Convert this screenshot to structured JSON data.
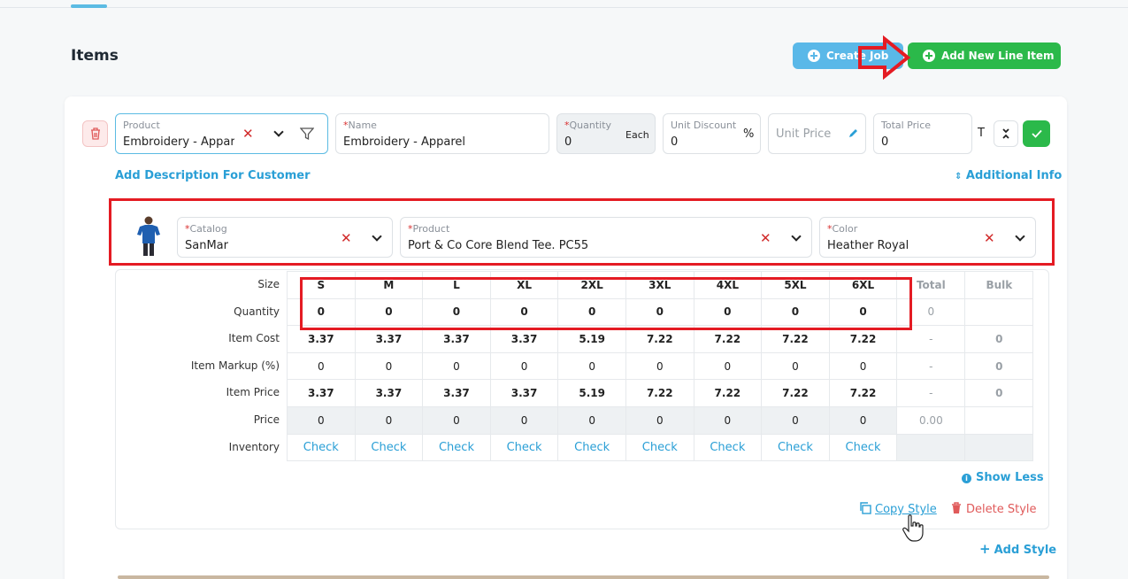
{
  "header": {
    "title": "Items"
  },
  "actions": {
    "create_job": "Create Job",
    "add_line_item": "Add New Line Item"
  },
  "line_item": {
    "product": {
      "label": "Product",
      "value": "Embroidery - Apparel"
    },
    "name": {
      "label": "Name",
      "value": "Embroidery - Apparel"
    },
    "quantity": {
      "label": "Quantity",
      "value": "0",
      "unit": "Each"
    },
    "unit_discount": {
      "label": "Unit Discount",
      "value": "0",
      "suffix": "%"
    },
    "unit_price": {
      "placeholder": "Unit Price"
    },
    "total_price": {
      "label": "Total Price",
      "value": "0"
    },
    "t_label": "T",
    "add_description": "Add Description For Customer",
    "additional_info": "Additional Info"
  },
  "style": {
    "catalog": {
      "label": "Catalog",
      "value": "SanMar"
    },
    "product": {
      "label": "Product",
      "value": "Port & Co Core Blend Tee. PC55"
    },
    "color": {
      "label": "Color",
      "value": "Heather Royal"
    }
  },
  "size_grid": {
    "row_labels": [
      "Size",
      "Quantity",
      "Item Cost",
      "Item Markup (%)",
      "Item Price",
      "Price",
      "Inventory"
    ],
    "sizes": [
      "S",
      "M",
      "L",
      "XL",
      "2XL",
      "3XL",
      "4XL",
      "5XL",
      "6XL"
    ],
    "extra_headers": [
      "Total",
      "Bulk"
    ],
    "quantity": [
      "0",
      "0",
      "0",
      "0",
      "0",
      "0",
      "0",
      "0",
      "0"
    ],
    "quantity_total": "0",
    "item_cost": [
      "3.37",
      "3.37",
      "3.37",
      "3.37",
      "5.19",
      "7.22",
      "7.22",
      "7.22",
      "7.22"
    ],
    "item_cost_total": "-",
    "item_cost_bulk": "0",
    "item_markup": [
      "0",
      "0",
      "0",
      "0",
      "0",
      "0",
      "0",
      "0",
      "0"
    ],
    "item_markup_total": "-",
    "item_markup_bulk": "0",
    "item_price": [
      "3.37",
      "3.37",
      "3.37",
      "3.37",
      "5.19",
      "7.22",
      "7.22",
      "7.22",
      "7.22"
    ],
    "item_price_total": "-",
    "item_price_bulk": "0",
    "price": [
      "0",
      "0",
      "0",
      "0",
      "0",
      "0",
      "0",
      "0",
      "0"
    ],
    "price_total": "0.00",
    "inventory_label": "Check"
  },
  "footer": {
    "show_less": "Show Less",
    "copy_style": "Copy Style",
    "delete_style": "Delete Style",
    "add_style": "Add Style"
  },
  "colors": {
    "create_job": "#5ab8e8",
    "add_line_item": "#2bb94a",
    "annotation": "#e41b23",
    "link": "#2a9fd6"
  }
}
